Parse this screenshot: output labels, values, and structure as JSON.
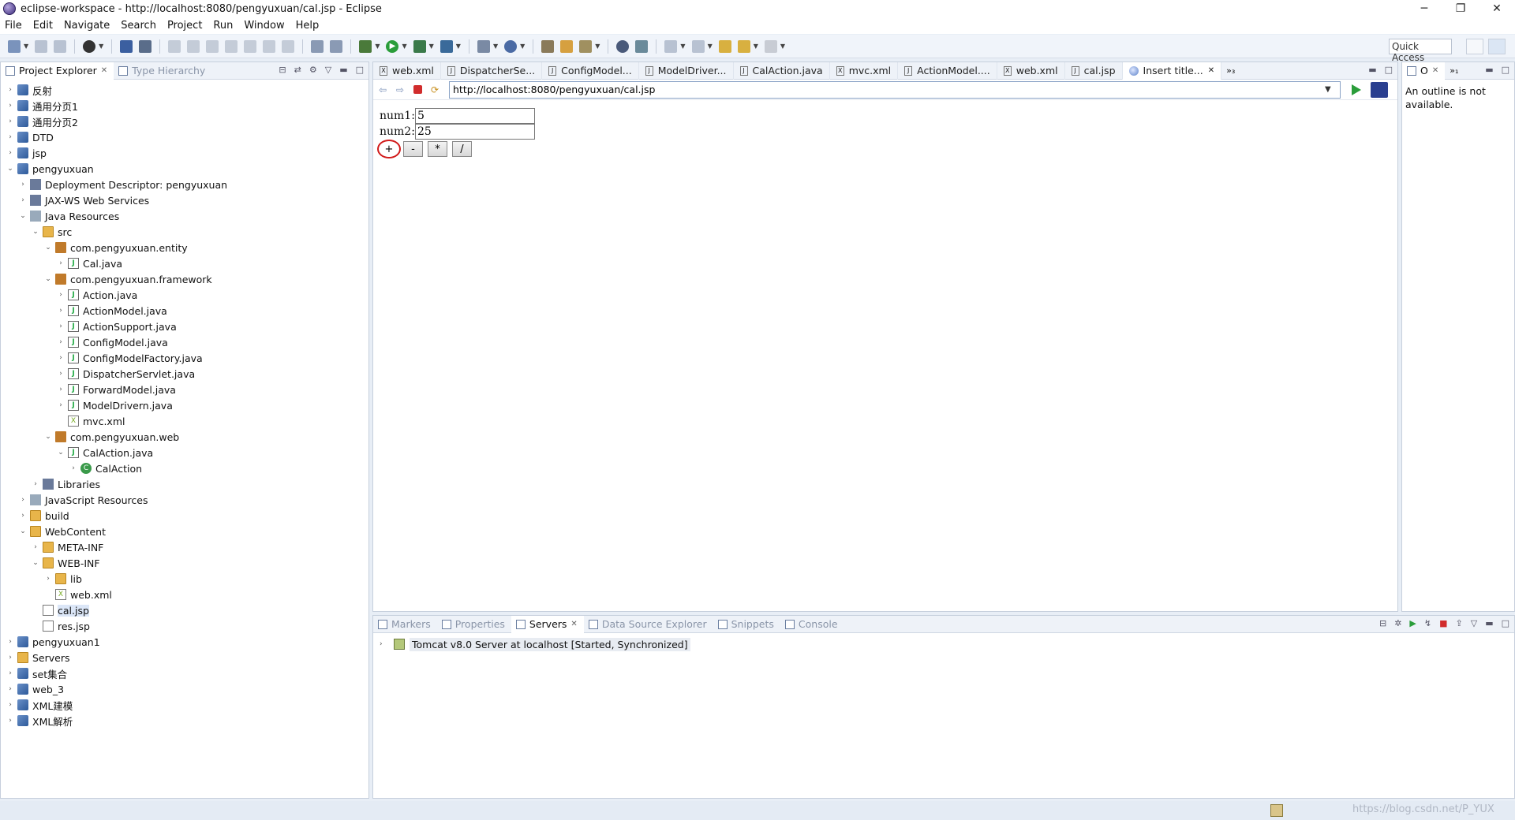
{
  "window": {
    "title": "eclipse-workspace - http://localhost:8080/pengyuxuan/cal.jsp - Eclipse"
  },
  "menu": [
    "File",
    "Edit",
    "Navigate",
    "Search",
    "Project",
    "Run",
    "Window",
    "Help"
  ],
  "toolbar": {
    "quick_access": "Quick Access"
  },
  "left_tabs": {
    "project_explorer": "Project Explorer",
    "type_hierarchy": "Type Hierarchy"
  },
  "tree": [
    {
      "label": "反射",
      "depth": 0,
      "icon": "project-icon",
      "exp": "closed"
    },
    {
      "label": "通用分页1",
      "depth": 0,
      "icon": "project-icon",
      "exp": "closed"
    },
    {
      "label": "通用分页2",
      "depth": 0,
      "icon": "project-icon",
      "exp": "closed"
    },
    {
      "label": "DTD",
      "depth": 0,
      "icon": "project-icon",
      "exp": "closed"
    },
    {
      "label": "jsp",
      "depth": 0,
      "icon": "project-icon",
      "exp": "closed"
    },
    {
      "label": "pengyuxuan",
      "depth": 0,
      "icon": "project-icon",
      "exp": "open"
    },
    {
      "label": "Deployment Descriptor: pengyuxuan",
      "depth": 1,
      "icon": "descriptor-icon",
      "exp": "closed"
    },
    {
      "label": "JAX-WS Web Services",
      "depth": 1,
      "icon": "webservice-icon",
      "exp": "closed"
    },
    {
      "label": "Java Resources",
      "depth": 1,
      "icon": "java-resources-icon",
      "exp": "open"
    },
    {
      "label": "src",
      "depth": 2,
      "icon": "source-folder-icon",
      "exp": "open"
    },
    {
      "label": "com.pengyuxuan.entity",
      "depth": 3,
      "icon": "package-icon",
      "exp": "open"
    },
    {
      "label": "Cal.java",
      "depth": 4,
      "icon": "java-file-icon",
      "exp": "closed"
    },
    {
      "label": "com.pengyuxuan.framework",
      "depth": 3,
      "icon": "package-icon",
      "exp": "open"
    },
    {
      "label": "Action.java",
      "depth": 4,
      "icon": "java-file-icon",
      "exp": "closed"
    },
    {
      "label": "ActionModel.java",
      "depth": 4,
      "icon": "java-file-icon",
      "exp": "closed"
    },
    {
      "label": "ActionSupport.java",
      "depth": 4,
      "icon": "java-file-icon",
      "exp": "closed"
    },
    {
      "label": "ConfigModel.java",
      "depth": 4,
      "icon": "java-file-icon",
      "exp": "closed"
    },
    {
      "label": "ConfigModelFactory.java",
      "depth": 4,
      "icon": "java-file-icon",
      "exp": "closed"
    },
    {
      "label": "DispatcherServlet.java",
      "depth": 4,
      "icon": "java-file-icon",
      "exp": "closed"
    },
    {
      "label": "ForwardModel.java",
      "depth": 4,
      "icon": "java-file-icon",
      "exp": "closed"
    },
    {
      "label": "ModelDrivern.java",
      "depth": 4,
      "icon": "java-file-icon",
      "exp": "closed"
    },
    {
      "label": "mvc.xml",
      "depth": 4,
      "icon": "xml-file-icon",
      "exp": "none"
    },
    {
      "label": "com.pengyuxuan.web",
      "depth": 3,
      "icon": "package-icon",
      "exp": "open"
    },
    {
      "label": "CalAction.java",
      "depth": 4,
      "icon": "java-file-icon",
      "exp": "open"
    },
    {
      "label": "CalAction",
      "depth": 5,
      "icon": "class-icon",
      "exp": "closed"
    },
    {
      "label": "Libraries",
      "depth": 2,
      "icon": "libraries-icon",
      "exp": "closed"
    },
    {
      "label": "JavaScript Resources",
      "depth": 1,
      "icon": "js-resources-icon",
      "exp": "closed"
    },
    {
      "label": "build",
      "depth": 1,
      "icon": "folder-icon",
      "exp": "closed"
    },
    {
      "label": "WebContent",
      "depth": 1,
      "icon": "folder-icon",
      "exp": "open"
    },
    {
      "label": "META-INF",
      "depth": 2,
      "icon": "folder-icon",
      "exp": "closed"
    },
    {
      "label": "WEB-INF",
      "depth": 2,
      "icon": "folder-icon",
      "exp": "open"
    },
    {
      "label": "lib",
      "depth": 3,
      "icon": "folder-icon",
      "exp": "closed"
    },
    {
      "label": "web.xml",
      "depth": 3,
      "icon": "xml-file-icon",
      "exp": "none"
    },
    {
      "label": "cal.jsp",
      "depth": 2,
      "icon": "jsp-file-icon",
      "exp": "none",
      "selected": true
    },
    {
      "label": "res.jsp",
      "depth": 2,
      "icon": "jsp-file-icon",
      "exp": "none"
    },
    {
      "label": "pengyuxuan1",
      "depth": 0,
      "icon": "project-icon",
      "exp": "closed"
    },
    {
      "label": "Servers",
      "depth": 0,
      "icon": "folder-icon",
      "exp": "closed"
    },
    {
      "label": "set集合",
      "depth": 0,
      "icon": "project-icon",
      "exp": "closed"
    },
    {
      "label": "web_3",
      "depth": 0,
      "icon": "project-icon",
      "exp": "closed"
    },
    {
      "label": "XML建模",
      "depth": 0,
      "icon": "project-icon",
      "exp": "closed"
    },
    {
      "label": "XML解析",
      "depth": 0,
      "icon": "project-icon",
      "exp": "closed"
    }
  ],
  "editor_tabs": [
    {
      "label": "web.xml",
      "icon": "xml-file-icon"
    },
    {
      "label": "DispatcherSe...",
      "icon": "java-file-icon"
    },
    {
      "label": "ConfigModel...",
      "icon": "java-file-icon"
    },
    {
      "label": "ModelDriver...",
      "icon": "java-file-icon"
    },
    {
      "label": "CalAction.java",
      "icon": "java-file-icon"
    },
    {
      "label": "mvc.xml",
      "icon": "xml-file-icon"
    },
    {
      "label": "ActionModel....",
      "icon": "java-file-icon"
    },
    {
      "label": "web.xml",
      "icon": "xml-file-icon"
    },
    {
      "label": "cal.jsp",
      "icon": "jsp-file-icon"
    },
    {
      "label": "Insert title...",
      "icon": "globe-icon",
      "active": true
    }
  ],
  "editor_overflow": "»₃",
  "browser": {
    "url": "http://localhost:8080/pengyuxuan/cal.jsp"
  },
  "form": {
    "num1_label": "num1:",
    "num1_value": "5",
    "num2_label": "num2:",
    "num2_value": "25",
    "ops": [
      "+",
      "-",
      "*",
      "/"
    ]
  },
  "outline": {
    "tab": "O",
    "overflow": "»₁",
    "message": "An outline is not available."
  },
  "bottom_tabs": [
    {
      "label": "Markers",
      "icon": "markers-icon"
    },
    {
      "label": "Properties",
      "icon": "properties-icon"
    },
    {
      "label": "Servers",
      "icon": "servers-icon",
      "active": true
    },
    {
      "label": "Data Source Explorer",
      "icon": "datasource-icon"
    },
    {
      "label": "Snippets",
      "icon": "snippets-icon"
    },
    {
      "label": "Console",
      "icon": "console-icon"
    }
  ],
  "servers": [
    {
      "label": "Tomcat v8.0 Server at localhost  [Started, Synchronized]"
    }
  ],
  "status": {
    "watermark": "https://blog.csdn.net/P_YUX"
  },
  "colors": {
    "accent": "#d11a1a",
    "run_green": "#2a9d3a",
    "selection": "#dbe6f7"
  }
}
